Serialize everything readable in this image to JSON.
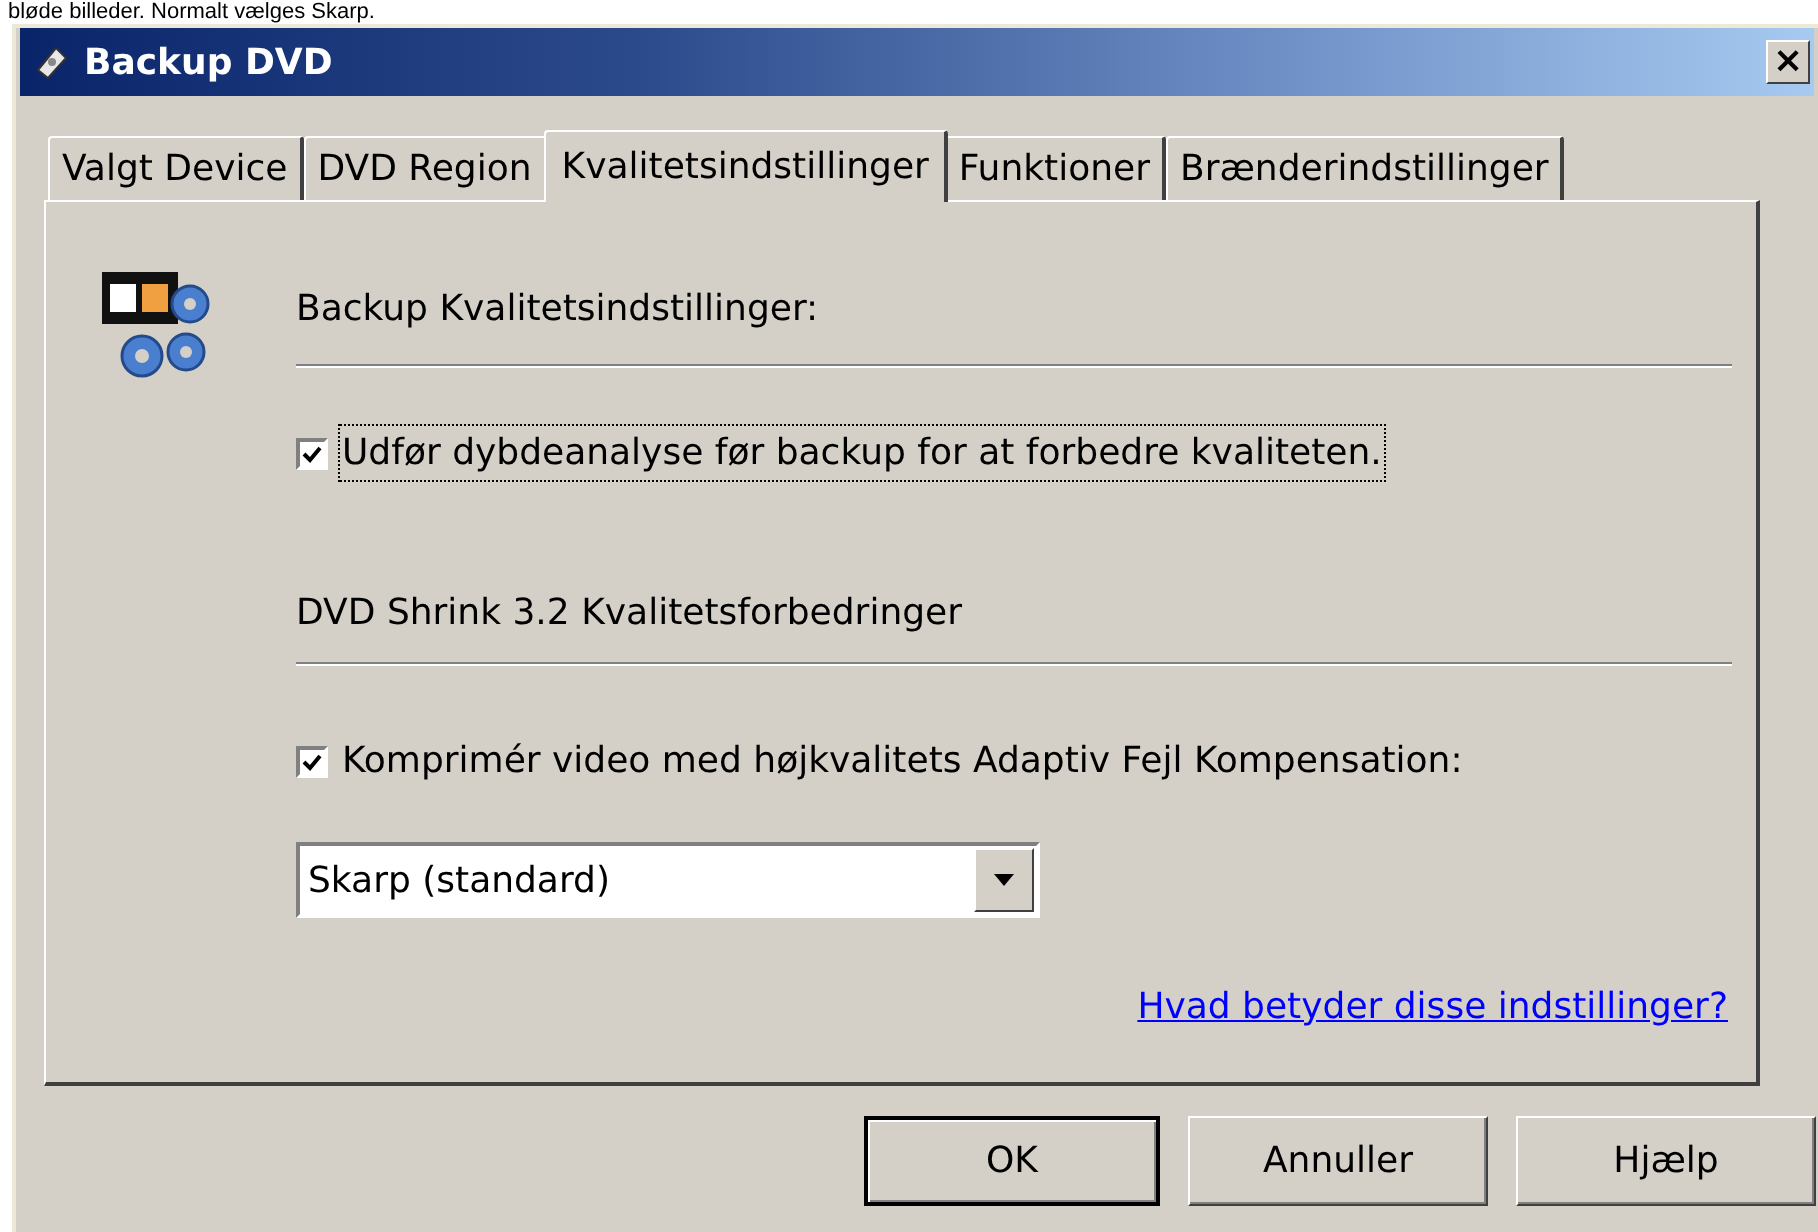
{
  "caption": "bløde billeder. Normalt vælges Skarp.",
  "window": {
    "title": "Backup DVD",
    "close": "×"
  },
  "tabs": [
    {
      "label": "Valgt Device",
      "selected": false
    },
    {
      "label": "DVD Region",
      "selected": false
    },
    {
      "label": "Kvalitetsindstillinger",
      "selected": true
    },
    {
      "label": "Funktioner",
      "selected": false
    },
    {
      "label": "Brænderindstillinger",
      "selected": false
    }
  ],
  "sections": [
    {
      "heading": "Backup Kvalitetsindstillinger:",
      "checkbox": {
        "label": "Udfør dybdeanalyse før backup for at forbedre kvaliteten.",
        "checked": true,
        "focused": true
      }
    },
    {
      "heading": "DVD Shrink 3.2 Kvalitetsforbedringer",
      "checkbox": {
        "label": "Komprimér video med højkvalitets Adaptiv Fejl Kompensation:",
        "checked": true,
        "focused": false
      },
      "dropdown": {
        "value": "Skarp (standard)"
      }
    }
  ],
  "help_link": "Hvad betyder disse indstillinger?",
  "buttons": [
    {
      "label": "OK",
      "default": true
    },
    {
      "label": "Annuller",
      "default": false
    },
    {
      "label": "Hjælp",
      "default": false
    }
  ]
}
